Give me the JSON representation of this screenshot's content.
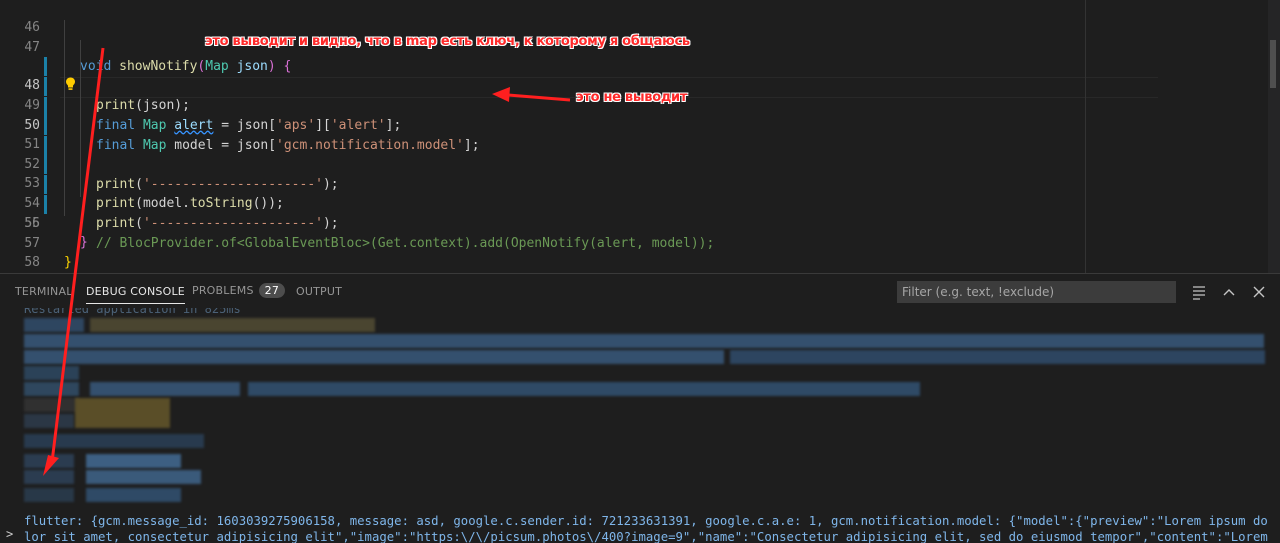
{
  "editor": {
    "lines": [
      {
        "num": "46"
      },
      {
        "num": "47",
        "tokens": [
          "void",
          "showNotify",
          "(",
          "Map",
          "json",
          ")",
          "{"
        ]
      },
      {
        "num": "48",
        "tokens": [
          "print",
          "(json);"
        ]
      },
      {
        "num": "49",
        "tokens": [
          "final",
          "Map",
          "alert",
          " = json[",
          "'aps'",
          "][",
          "'alert'",
          "];"
        ]
      },
      {
        "num": "50",
        "tokens": [
          "final",
          "Map",
          "model = json[",
          "'gcm.notification.model'",
          "];"
        ]
      },
      {
        "num": "51"
      },
      {
        "num": "52",
        "tokens": [
          "print",
          "(",
          "'---------------------'",
          ");"
        ]
      },
      {
        "num": "53",
        "tokens": [
          "print",
          "(model.",
          "toString",
          "());"
        ]
      },
      {
        "num": "54",
        "tokens": [
          "print",
          "(",
          "'---------------------'",
          ");"
        ]
      },
      {
        "num": "55",
        "tokens": [
          "// BlocProvider.of<GlobalEventBloc>(Get.context).add(OpenNotify(alert, model));"
        ]
      },
      {
        "num": "56",
        "tokens": [
          "}"
        ]
      },
      {
        "num": "57",
        "tokens": [
          "}"
        ]
      },
      {
        "num": "58"
      }
    ]
  },
  "annotations": {
    "top": "это выводит и видно, что в map есть ключ, к которому я общаюсь",
    "right": "это не выводит"
  },
  "panel": {
    "tabs": {
      "terminal": "TERMINAL",
      "debug_console": "DEBUG CONSOLE",
      "problems": "PROBLEMS",
      "problems_count": "27",
      "output": "OUTPUT"
    },
    "filter_placeholder": "Filter (e.g. text, !exclude)",
    "clipped_line": "Restarted application in 825ms",
    "output_text": "flutter: {gcm.message_id: 1603039275906158, message: asd, google.c.sender.id: 721233631391, google.c.a.e: 1, gcm.notification.model: {\"model\":{\"preview\":\"Lorem ipsum dolor sit amet, consectetur adipisicing elit\",\"image\":\"https:\\/\\/picsum.photos\\/400?image=9\",\"name\":\"Consectetur adipisicing elit, sed do eiusmod tempor\",\"content\":\"Lorem ipsum dolor sit amet, \"},\"hero-tag\":\"false\"}, aps: {alert: {title: asd, body: asd}, sound: default, category: /screena}}",
    "prompt": ">"
  },
  "colors": {
    "background": "#1e1e1e",
    "annotation": "#ff2a2a",
    "output": "#7fb6ea",
    "modified_gutter": "#1b81a8"
  }
}
